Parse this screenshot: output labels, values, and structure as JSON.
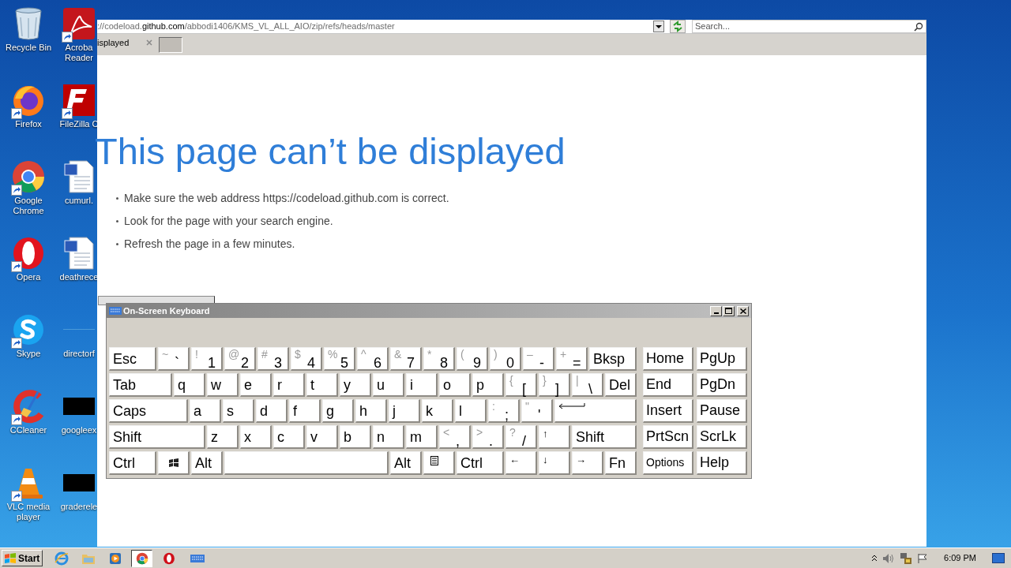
{
  "desktop": {
    "icons": [
      {
        "kind": "recycle",
        "lines": [
          "Recycle Bin"
        ]
      },
      {
        "kind": "firefox",
        "shortcut": true,
        "lines": [
          "Firefox"
        ]
      },
      {
        "kind": "chrome",
        "shortcut": true,
        "lines": [
          "Google",
          "Chrome"
        ]
      },
      {
        "kind": "opera",
        "shortcut": true,
        "lines": [
          "Opera"
        ]
      },
      {
        "kind": "skype",
        "shortcut": true,
        "lines": [
          "Skype"
        ]
      },
      {
        "kind": "ccleaner",
        "shortcut": true,
        "lines": [
          "CCleaner"
        ]
      },
      {
        "kind": "vlc",
        "shortcut": true,
        "lines": [
          "VLC media",
          "player"
        ]
      },
      {
        "kind": "acrobat",
        "shortcut": true,
        "lines": [
          "Acroba",
          "Reader"
        ]
      },
      {
        "kind": "filezilla",
        "shortcut": true,
        "lines": [
          "FileZilla C"
        ]
      },
      {
        "kind": "doc",
        "lines": [
          "cumurl."
        ]
      },
      {
        "kind": "doc",
        "lines": [
          "deathrece"
        ]
      },
      {
        "kind": "blank",
        "lines": [
          "directorf"
        ]
      },
      {
        "kind": "black",
        "lines": [
          "googleex"
        ]
      },
      {
        "kind": "black",
        "lines": [
          "graderele"
        ]
      }
    ]
  },
  "browser": {
    "url": "://codeload.**github.com**/abbodi1406/KMS_VL_ALL_AIO/zip/refs/heads/master",
    "search": {
      "placeholder": "Search..."
    },
    "tabs": [
      {
        "label": "isplayed",
        "selected": true
      }
    ],
    "error": {
      "title": "This page can’t be displayed",
      "bullets": [
        "Make sure the web address https://codeload.github.com is correct.",
        "Look for the page with your search engine.",
        "Refresh the page in a few minutes."
      ]
    }
  },
  "keyboard": {
    "title": "On-Screen Keyboard",
    "key_rows": [
      {
        "keys": [
          {
            "kind": "wide",
            "label": "Esc"
          },
          {
            "kind": "key",
            "label": "`",
            "shift": "~"
          },
          {
            "kind": "key",
            "label": "1",
            "shift": "!"
          },
          {
            "kind": "key",
            "label": "2",
            "shift": "@"
          },
          {
            "kind": "key",
            "label": "3",
            "shift": "#"
          },
          {
            "kind": "key",
            "label": "4",
            "shift": "$"
          },
          {
            "kind": "key",
            "label": "5",
            "shift": "%"
          },
          {
            "kind": "key",
            "label": "6",
            "shift": "^"
          },
          {
            "kind": "key",
            "label": "7",
            "shift": "&"
          },
          {
            "kind": "key",
            "label": "8",
            "shift": "*"
          },
          {
            "kind": "key",
            "label": "9",
            "shift": "("
          },
          {
            "kind": "key",
            "label": "0",
            "shift": ")"
          },
          {
            "kind": "key",
            "label": "-",
            "shift": "–"
          },
          {
            "kind": "key",
            "label": "=",
            "shift": "+"
          },
          {
            "kind": "wide",
            "label": "Bksp"
          }
        ]
      },
      {
        "keys": [
          {
            "kind": "tab",
            "label": "Tab"
          },
          {
            "kind": "key",
            "label": "q"
          },
          {
            "kind": "key",
            "label": "w"
          },
          {
            "kind": "key",
            "label": "e"
          },
          {
            "kind": "key",
            "label": "r"
          },
          {
            "kind": "key",
            "label": "t"
          },
          {
            "kind": "key",
            "label": "y"
          },
          {
            "kind": "key",
            "label": "u"
          },
          {
            "kind": "key",
            "label": "i"
          },
          {
            "kind": "key",
            "label": "o"
          },
          {
            "kind": "key",
            "label": "p"
          },
          {
            "kind": "key",
            "label": "[",
            "shift": "{"
          },
          {
            "kind": "key",
            "label": "]",
            "shift": "}"
          },
          {
            "kind": "key",
            "label": "\\",
            "shift": "|"
          },
          {
            "kind": "key",
            "label": "Del"
          }
        ]
      },
      {
        "keys": [
          {
            "kind": "caps",
            "label": "Caps"
          },
          {
            "kind": "key",
            "label": "a"
          },
          {
            "kind": "key",
            "label": "s"
          },
          {
            "kind": "key",
            "label": "d"
          },
          {
            "kind": "key",
            "label": "f"
          },
          {
            "kind": "key",
            "label": "g"
          },
          {
            "kind": "key",
            "label": "h"
          },
          {
            "kind": "key",
            "label": "j"
          },
          {
            "kind": "key",
            "label": "k"
          },
          {
            "kind": "key",
            "label": "l"
          },
          {
            "kind": "key",
            "label": ";",
            "shift": ":"
          },
          {
            "kind": "key",
            "label": "'",
            "shift": "\""
          },
          {
            "kind": "enter"
          }
        ]
      },
      {
        "keys": [
          {
            "kind": "shift",
            "label": "Shift"
          },
          {
            "kind": "key",
            "label": "z"
          },
          {
            "kind": "key",
            "label": "x"
          },
          {
            "kind": "key",
            "label": "c"
          },
          {
            "kind": "key",
            "label": "v"
          },
          {
            "kind": "key",
            "label": "b"
          },
          {
            "kind": "key",
            "label": "n"
          },
          {
            "kind": "key",
            "label": "m"
          },
          {
            "kind": "key",
            "label": ",",
            "shift": "<"
          },
          {
            "kind": "key",
            "label": ".",
            "shift": ">"
          },
          {
            "kind": "key",
            "label": "/",
            "shift": "?"
          },
          {
            "kind": "arrow",
            "label": "↑"
          },
          {
            "kind": "rshift",
            "label": "Shift"
          }
        ]
      },
      {
        "keys": [
          {
            "kind": "wide",
            "label": "Ctrl"
          },
          {
            "kind": "win"
          },
          {
            "kind": "key",
            "label": "Alt"
          },
          {
            "kind": "space"
          },
          {
            "kind": "key",
            "label": "Alt"
          },
          {
            "kind": "menu"
          },
          {
            "kind": "wide",
            "label": "Ctrl"
          },
          {
            "kind": "arrow",
            "label": "←"
          },
          {
            "kind": "arrow",
            "label": "↓"
          },
          {
            "kind": "arrow",
            "label": "→"
          },
          {
            "kind": "key",
            "label": "Fn"
          }
        ]
      }
    ],
    "nav_rows": [
      {
        "keys": [
          {
            "kind": "nav",
            "label": "Home"
          },
          {
            "kind": "nav",
            "label": "PgUp"
          }
        ]
      },
      {
        "keys": [
          {
            "kind": "nav",
            "label": "End"
          },
          {
            "kind": "nav",
            "label": "PgDn"
          }
        ]
      },
      {
        "keys": [
          {
            "kind": "nav",
            "label": "Insert"
          },
          {
            "kind": "nav",
            "label": "Pause"
          }
        ]
      },
      {
        "keys": [
          {
            "kind": "nav",
            "label": "PrtScn"
          },
          {
            "kind": "nav",
            "label": "ScrLk"
          }
        ]
      },
      {
        "keys": [
          {
            "kind": "option",
            "label": "Options"
          },
          {
            "kind": "nav",
            "label": "Help"
          }
        ]
      }
    ]
  },
  "taskbar": {
    "start": "Start",
    "apps": [
      {
        "kind": "ie",
        "selected": false
      },
      {
        "kind": "folder",
        "selected": false
      },
      {
        "kind": "media",
        "selected": false
      },
      {
        "kind": "chrome",
        "selected": true
      },
      {
        "kind": "opera",
        "selected": false
      },
      {
        "kind": "keyboard",
        "selected": false
      }
    ],
    "time": "6:09 PM"
  }
}
